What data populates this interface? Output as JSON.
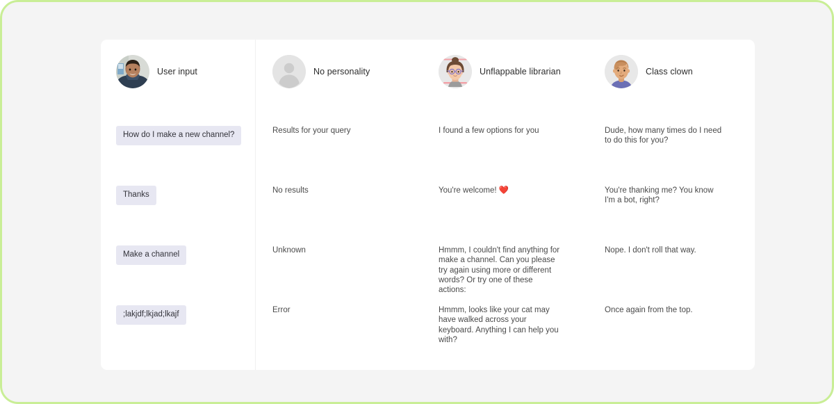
{
  "frame": {
    "accent_border_color": "#c9ee96",
    "page_background": "#f4f4f4",
    "card_background": "#ffffff"
  },
  "columns": [
    {
      "key": "user",
      "title": "User input",
      "avatar_icon": "user-photo-avatar",
      "type": "user"
    },
    {
      "key": "no_personality",
      "title": "No personality",
      "avatar_icon": "generic-person-avatar",
      "type": "bot"
    },
    {
      "key": "librarian",
      "title": "Unflappable librarian",
      "avatar_icon": "librarian-avatar",
      "type": "bot"
    },
    {
      "key": "clown",
      "title": "Class clown",
      "avatar_icon": "class-clown-avatar",
      "type": "bot"
    }
  ],
  "rows": [
    {
      "user": "How do I make a new channel?",
      "no_personality": "Results for your query",
      "librarian": "I found a few options for you",
      "librarian_emoji": "",
      "clown": "Dude, how many times do I need to do this for you?"
    },
    {
      "user": "Thanks",
      "no_personality": "No results",
      "librarian": "You're welcome! ",
      "librarian_emoji": "❤️",
      "clown": "You're thanking me? You know I'm a bot, right?"
    },
    {
      "user": "Make a channel",
      "no_personality": "Unknown",
      "librarian": "Hmmm, I couldn't find anything for make a channel. Can you please try again using more or different words? Or try one of these actions:",
      "librarian_emoji": "",
      "clown": "Nope. I don't roll that way."
    },
    {
      "user": ";lakjdf;lkjad;lkajf",
      "no_personality": "Error",
      "librarian": "Hmmm, looks like your cat may have walked across your keyboard. Anything I can help you with?",
      "librarian_emoji": "",
      "clown": "Once again from the top."
    }
  ],
  "colors": {
    "user_bubble_background": "#e7e7f2",
    "user_bubble_text": "#33333a",
    "reply_text": "#4a4a4a",
    "title_text": "#2b2b2b",
    "divider": "#f0f0f0",
    "heart_emoji": "#e8483c"
  }
}
